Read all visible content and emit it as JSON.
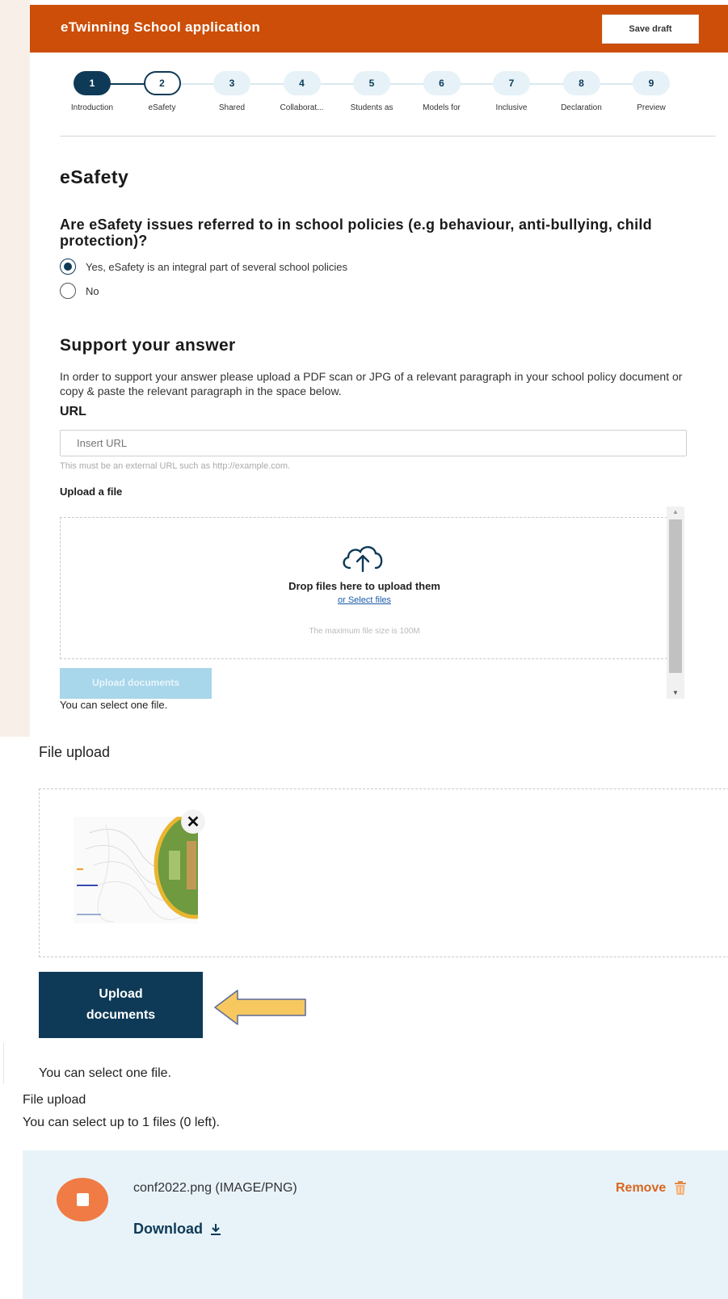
{
  "app": {
    "title": "eTwinning School application",
    "save_draft_label": "Save draft"
  },
  "stepper": {
    "steps": [
      {
        "number": "1",
        "label": "Introduction"
      },
      {
        "number": "2",
        "label": "eSafety"
      },
      {
        "number": "3",
        "label": "Shared"
      },
      {
        "number": "4",
        "label": "Collaborat..."
      },
      {
        "number": "5",
        "label": "Students as"
      },
      {
        "number": "6",
        "label": "Models for"
      },
      {
        "number": "7",
        "label": "Inclusive"
      },
      {
        "number": "8",
        "label": "Declaration"
      },
      {
        "number": "9",
        "label": "Preview"
      }
    ],
    "completed_step": "1",
    "current_step": "2"
  },
  "esafety": {
    "section_title": "eSafety",
    "question": "Are eSafety issues referred to in school policies (e.g behaviour, anti-bullying, child protection)?",
    "options": [
      {
        "label": "Yes, eSafety is an integral part of several school policies",
        "selected": true
      },
      {
        "label": "No",
        "selected": false
      }
    ]
  },
  "support": {
    "title": "Support your answer",
    "description": "In order to support your answer please upload a PDF scan or JPG of a relevant paragraph in your school policy document or copy & paste the relevant paragraph in the space below.",
    "url_label": "URL",
    "url_placeholder": "Insert URL",
    "url_help": "This must be an external URL such as http://example.com.",
    "upload_label": "Upload a file",
    "drop_text": "Drop files here to upload them",
    "select_files_link": "or Select files",
    "max_size_text": "The maximum file size is 100M",
    "upload_button_label": "Upload documents",
    "select_note": "You can select one file."
  },
  "upload_step2": {
    "title": "File upload",
    "upload_button_label": "Upload documents",
    "select_note": "You can select one file.",
    "close_glyph": "✕"
  },
  "upload_step3": {
    "title": "File upload",
    "limit_text": "You can select up to 1 files (0 left).",
    "file": {
      "name": "conf2022.png (IMAGE/PNG)"
    },
    "remove_label": "Remove",
    "download_label": "Download"
  },
  "colors": {
    "header": "#cc4e09",
    "primary": "#0e3a57",
    "remove": "#d9661e",
    "file_avatar": "#f07b45",
    "arrow": "#f6c85f"
  }
}
